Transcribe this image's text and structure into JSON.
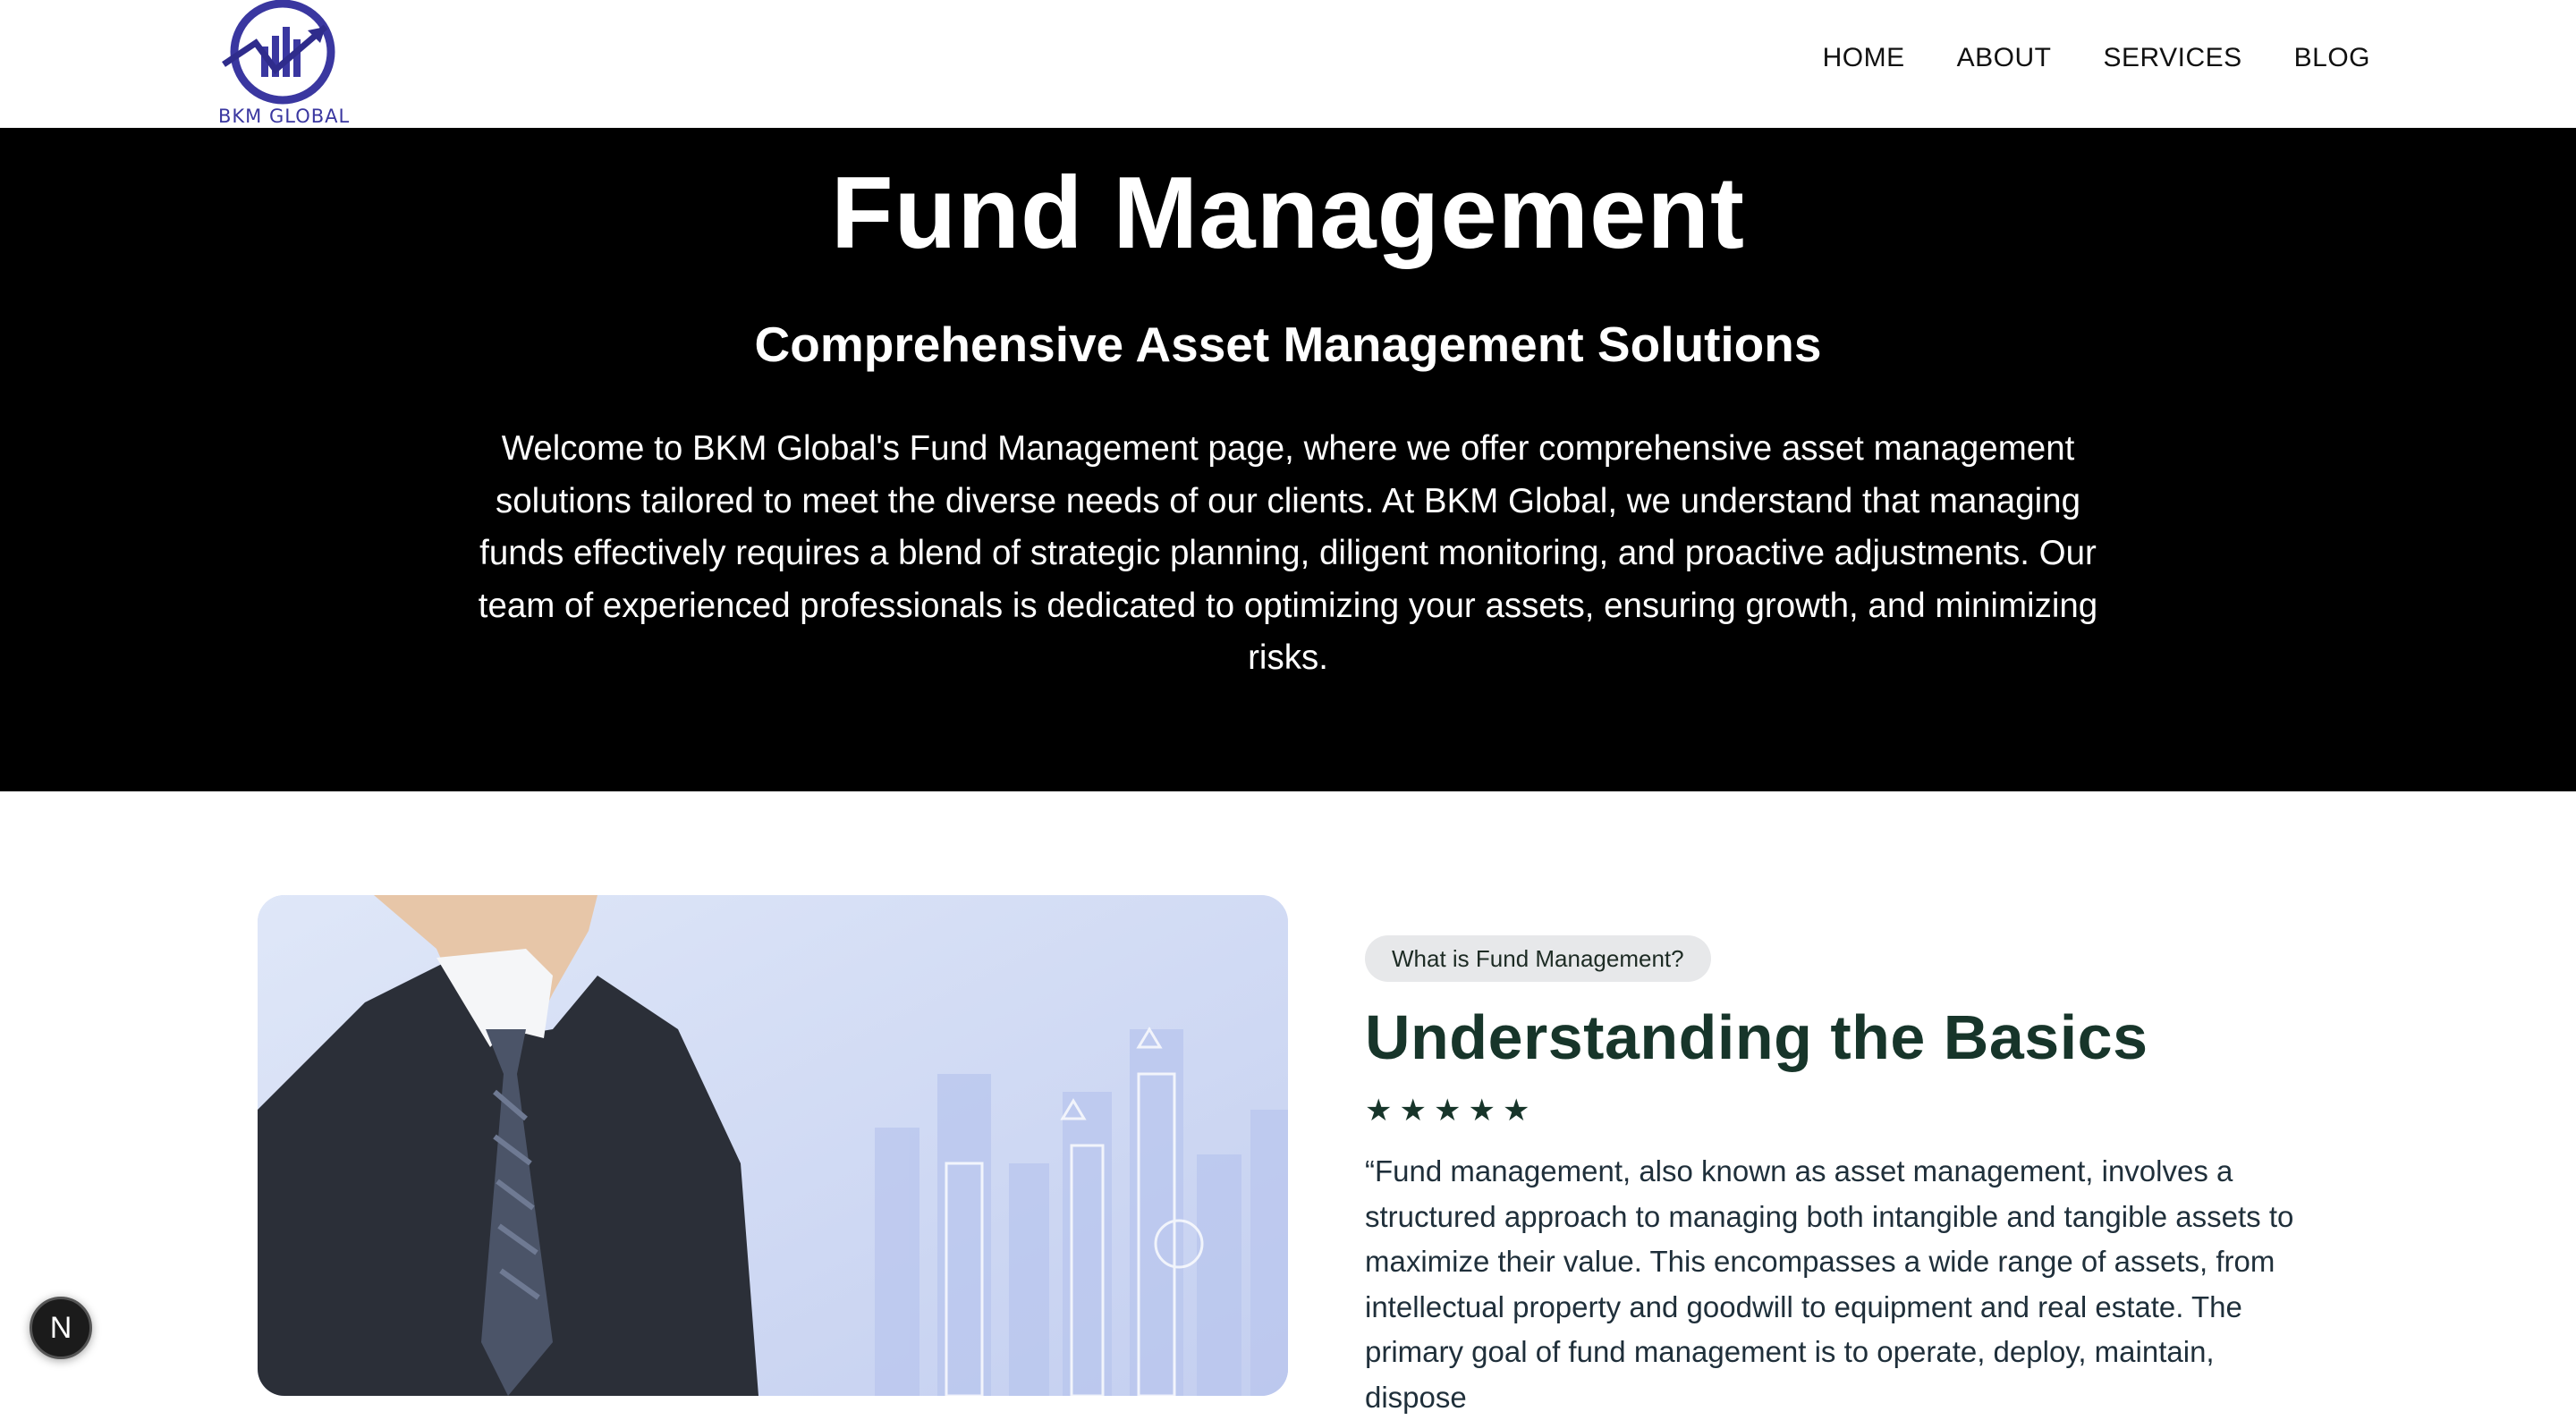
{
  "header": {
    "logo_text": "BKM GLOBAL",
    "nav": [
      {
        "label": "HOME"
      },
      {
        "label": "ABOUT"
      },
      {
        "label": "SERVICES"
      },
      {
        "label": "BLOG"
      }
    ]
  },
  "hero": {
    "title": "Fund Management",
    "subtitle": "Comprehensive Asset Management Solutions",
    "description": "Welcome to BKM Global's Fund Management page, where we offer comprehensive asset management solutions tailored to meet the diverse needs of our clients. At BKM Global, we understand that managing funds effectively requires a blend of strategic planning, diligent monitoring, and proactive adjustments. Our team of experienced professionals is dedicated to optimizing your assets, ensuring growth, and minimizing risks."
  },
  "about": {
    "badge": "What is Fund Management?",
    "title": "Understanding the Basics",
    "rating": 5,
    "text": "“Fund management, also known as asset management, involves a structured approach to managing both intangible and tangible assets to maximize their value. This encompasses a wide range of assets, from intellectual property and goodwill to equipment and real estate. The primary goal of fund management is to operate, deploy, maintain, dispose"
  },
  "dev_badge": {
    "letter": "N"
  },
  "colors": {
    "hero_bg": "#000000",
    "title_green": "#17352a",
    "logo_blue": "#3a37a0",
    "badge_bg": "#e7e8ea"
  }
}
